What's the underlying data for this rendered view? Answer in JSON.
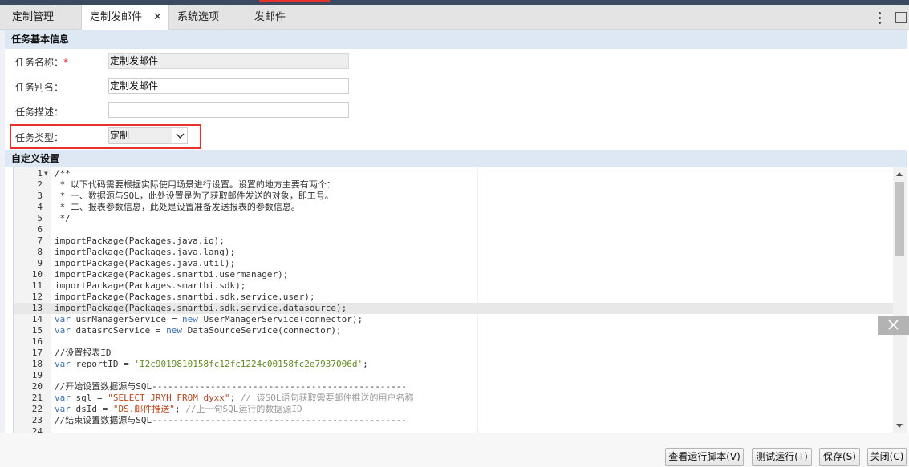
{
  "tabs": [
    {
      "label": "定制管理",
      "active": false
    },
    {
      "label": "定制发邮件",
      "active": true,
      "closable": true
    },
    {
      "label": "系统选项",
      "active": false
    },
    {
      "label": "发邮件",
      "active": false
    }
  ],
  "tab_close_glyph": "✕",
  "window_controls": {
    "menu": "more-vertical-icon",
    "maximize": "maximize-icon"
  },
  "basic_info": {
    "section_title": "任务基本信息",
    "name_label": "任务名称：",
    "required_mark": "*",
    "name_value": "定制发邮件",
    "alias_label": "任务别名：",
    "alias_value": "定制发邮件",
    "desc_label": "任务描述：",
    "desc_value": "",
    "type_label": "任务类型：",
    "type_value": "定制"
  },
  "custom_settings": {
    "section_title": "自定义设置"
  },
  "editor": {
    "active_line": 13,
    "lines": [
      {
        "n": "1",
        "text": "/**",
        "cls": "cm",
        "fold": true
      },
      {
        "n": "2",
        "text": " * 以下代码需要根据实际使用场景进行设置。设置的地方主要有两个：",
        "cls": "cm"
      },
      {
        "n": "3",
        "text": " * 一、数据源与SQL，此处设置是为了获取邮件发送的对象，即工号。",
        "cls": "cm"
      },
      {
        "n": "4",
        "text": " * 二、报表参数信息，此处是设置准备发送报表的参数信息。",
        "cls": "cm"
      },
      {
        "n": "5",
        "text": " */",
        "cls": "cm"
      },
      {
        "n": "6",
        "text": ""
      },
      {
        "n": "7",
        "text": "importPackage(Packages.java.io);"
      },
      {
        "n": "8",
        "text": "importPackage(Packages.java.lang);"
      },
      {
        "n": "9",
        "text": "importPackage(Packages.java.util);"
      },
      {
        "n": "10",
        "text": "importPackage(Packages.smartbi.usermanager);"
      },
      {
        "n": "11",
        "text": "importPackage(Packages.smartbi.sdk);"
      },
      {
        "n": "12",
        "text": "importPackage(Packages.smartbi.sdk.service.user);"
      },
      {
        "n": "13",
        "text": "importPackage(Packages.smartbi.sdk.service.datasource);"
      },
      {
        "n": "14",
        "parts": [
          {
            "t": "var",
            "c": "kw"
          },
          {
            "t": " usrManagerService = "
          },
          {
            "t": "new",
            "c": "kw"
          },
          {
            "t": " UserManagerService(connector);"
          }
        ]
      },
      {
        "n": "15",
        "parts": [
          {
            "t": "var",
            "c": "kw"
          },
          {
            "t": " datasrcService = "
          },
          {
            "t": "new",
            "c": "kw"
          },
          {
            "t": " DataSourceService(connector);"
          }
        ]
      },
      {
        "n": "16",
        "text": ""
      },
      {
        "n": "17",
        "text": "//设置报表ID",
        "cls": "cm"
      },
      {
        "n": "18",
        "parts": [
          {
            "t": "var",
            "c": "kw"
          },
          {
            "t": " reportID = "
          },
          {
            "t": "'I2c9019810158fc12fc1224c00158fc2e7937006d'",
            "c": "st2"
          },
          {
            "t": ";"
          }
        ]
      },
      {
        "n": "19",
        "text": ""
      },
      {
        "n": "20",
        "text": "//开始设置数据源与SQL------------------------------------------------",
        "cls": "cm"
      },
      {
        "n": "21",
        "parts": [
          {
            "t": "var",
            "c": "kw"
          },
          {
            "t": " sql = "
          },
          {
            "t": "\"SELECT JRYH FROM dyxx\"",
            "c": "st"
          },
          {
            "t": "; "
          },
          {
            "t": "// 该SQL语句获取需要邮件推送的用户名称",
            "c": "cm"
          }
        ]
      },
      {
        "n": "22",
        "parts": [
          {
            "t": "var",
            "c": "kw"
          },
          {
            "t": " dsId = "
          },
          {
            "t": "\"DS.邮件推送\"",
            "c": "st"
          },
          {
            "t": "; "
          },
          {
            "t": "//上一句SQL运行的数据源ID",
            "c": "cm"
          }
        ]
      },
      {
        "n": "23",
        "text": "//结束设置数据源与SQL------------------------------------------------",
        "cls": "cm"
      },
      {
        "n": "24",
        "text": ""
      }
    ]
  },
  "buttons": {
    "view_script": "查看运行脚本(V)",
    "test_run": "测试运行(T)",
    "save": "保存(S)",
    "close": "关闭(C)"
  },
  "float_close_glyph": "✕"
}
